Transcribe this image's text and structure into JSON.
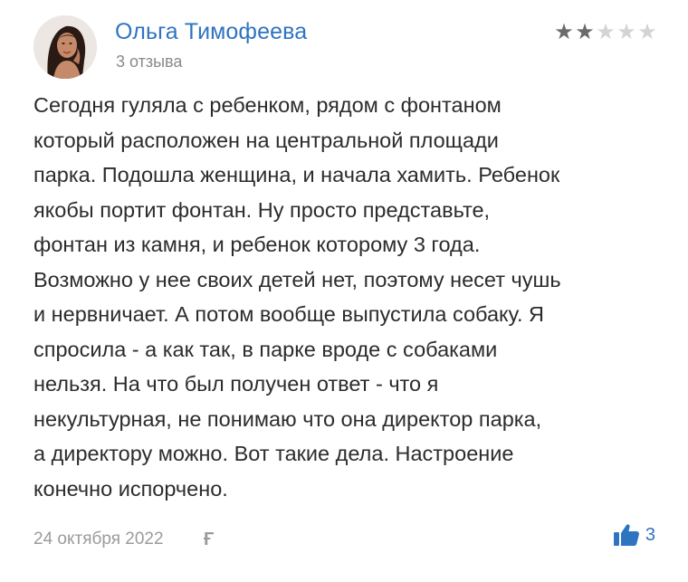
{
  "review": {
    "author": {
      "name": "Ольга Тимофеева",
      "review_count": "3 отзыва",
      "avatar": "avatar-photo"
    },
    "rating": {
      "value": 2,
      "max": 5,
      "filled_color": "#6b6b6b",
      "empty_color": "#d4d4d4"
    },
    "text_lines": [
      "Сегодня гуляла с ребенком, рядом с фонтаном",
      "который расположен на центральной площади",
      "парка. Подошла женщина, и начала хамить. Ребенок",
      "якобы портит фонтан. Ну просто представьте,",
      "фонтан из камня, и ребенок которому 3 года.",
      "Возможно у нее своих детей нет, поэтому несет чушь",
      "и нервничает. А потом вообще выпустила собаку. Я",
      "спросила - а как так, в парке вроде с собаками",
      "нельзя. На что был получен ответ - что я",
      "некультурная, не понимаю что она директор парка,",
      "а директору можно. Вот такие дела. Настроение",
      "конечно испорчено."
    ],
    "date": "24 октября 2022",
    "source_logo_text": "Ғ",
    "likes": "3",
    "like_icon": "thumbs-up-icon"
  },
  "colors": {
    "author_name": "#2f74c0",
    "accent": "#2f74c0",
    "text": "#2c2c2c",
    "muted": "#9b9b9b"
  }
}
